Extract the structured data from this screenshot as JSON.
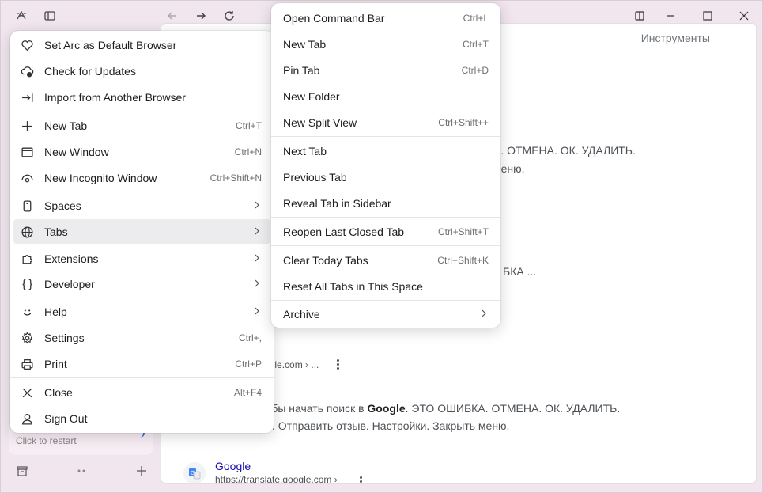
{
  "content": {
    "tools_label": "Инструменты",
    "snippet_lines": [
      {
        "text": "А. ОТМЕНА. ОК. УДАЛИТЬ.",
        "bold": ""
      },
      {
        "text": "меню.",
        "bold": ""
      },
      {
        "text": "БКА ...",
        "bold": ""
      },
      {
        "text": "ogle.com › ...",
        "bold": ""
      }
    ],
    "snippet_a_pre": "чтобы начать поиск в ",
    "snippet_a_bold": "Google",
    "snippet_a_post": ". ЭТО ОШИБКА. ОТМЕНА. ОК. УДАЛИТЬ.",
    "snippet_b": ". Отправить отзыв. Настройки. Закрыть меню.",
    "result_title": "Google",
    "result_url": "https://translate.google.com ›"
  },
  "sidebar": {
    "restart_text": "Click to restart"
  },
  "menu_left": {
    "items": [
      {
        "label": "Set Arc as Default Browser",
        "shortcut": "",
        "icon": "heart-icon"
      },
      {
        "label": "Check for Updates",
        "shortcut": "",
        "icon": "cloud-update-icon"
      },
      {
        "label": "Import from Another Browser",
        "shortcut": "",
        "icon": "import-arrow-icon"
      },
      {
        "label": "New Tab",
        "shortcut": "Ctrl+T",
        "icon": "plus-icon"
      },
      {
        "label": "New Window",
        "shortcut": "Ctrl+N",
        "icon": "window-icon"
      },
      {
        "label": "New Incognito Window",
        "shortcut": "Ctrl+Shift+N",
        "icon": "incognito-icon"
      },
      {
        "label": "Spaces",
        "shortcut": "",
        "icon": "spaces-icon"
      },
      {
        "label": "Tabs",
        "shortcut": "",
        "icon": "globe-icon"
      },
      {
        "label": "Extensions",
        "shortcut": "",
        "icon": "puzzle-icon"
      },
      {
        "label": "Developer",
        "shortcut": "",
        "icon": "braces-icon"
      },
      {
        "label": "Help",
        "shortcut": "",
        "icon": "smile-icon"
      },
      {
        "label": "Settings",
        "shortcut": "Ctrl+,",
        "icon": "gear-icon"
      },
      {
        "label": "Print",
        "shortcut": "Ctrl+P",
        "icon": "printer-icon"
      },
      {
        "label": "Close",
        "shortcut": "Alt+F4",
        "icon": "close-icon"
      },
      {
        "label": "Sign Out",
        "shortcut": "",
        "icon": "user-icon"
      }
    ]
  },
  "menu_right": {
    "items": [
      {
        "label": "Open Command Bar",
        "shortcut": "Ctrl+L"
      },
      {
        "label": "New Tab",
        "shortcut": "Ctrl+T"
      },
      {
        "label": "Pin Tab",
        "shortcut": "Ctrl+D"
      },
      {
        "label": "New Folder",
        "shortcut": ""
      },
      {
        "label": "New Split View",
        "shortcut": "Ctrl+Shift++"
      },
      {
        "label": "Next Tab",
        "shortcut": ""
      },
      {
        "label": "Previous Tab",
        "shortcut": ""
      },
      {
        "label": "Reveal Tab in Sidebar",
        "shortcut": ""
      },
      {
        "label": "Reopen Last Closed Tab",
        "shortcut": "Ctrl+Shift+T"
      },
      {
        "label": "Clear Today Tabs",
        "shortcut": "Ctrl+Shift+K"
      },
      {
        "label": "Reset All Tabs in This Space",
        "shortcut": ""
      },
      {
        "label": "Archive",
        "shortcut": ""
      }
    ]
  }
}
